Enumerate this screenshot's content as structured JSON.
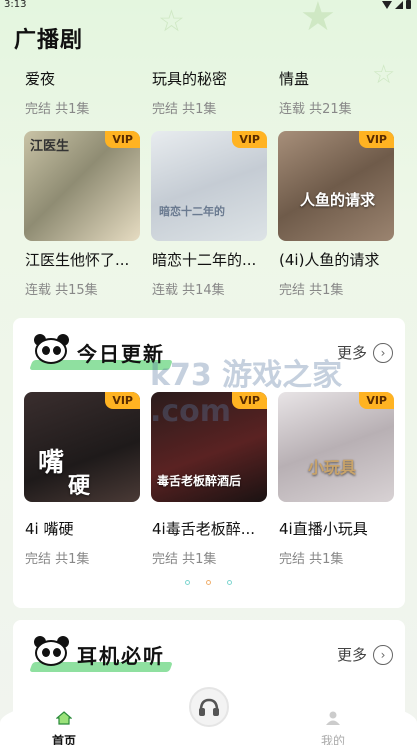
{
  "status_bar": {
    "time": "3:13"
  },
  "page": {
    "title": "广播剧"
  },
  "top_row": [
    {
      "title": "爱夜",
      "sub": "完结 共1集"
    },
    {
      "title": "玩具的秘密",
      "sub": "完结 共1集"
    },
    {
      "title": "情蛊",
      "sub": "连载 共21集"
    }
  ],
  "second_row": [
    {
      "title": "江医生他怀了...",
      "sub": "连载 共15集",
      "badge": "VIP",
      "cover_text": "江医生"
    },
    {
      "title": "暗恋十二年的...",
      "sub": "连载 共14集",
      "badge": "VIP",
      "cover_text": "暗恋十二年的"
    },
    {
      "title": "(4i)人鱼的请求",
      "sub": "完结 共1集",
      "badge": "VIP",
      "cover_text": "人鱼的请求"
    }
  ],
  "today_section": {
    "title": "今日更新",
    "more": "更多",
    "items": [
      {
        "title": "4i 嘴硬",
        "sub": "完结 共1集",
        "badge": "VIP",
        "cover_text_1": "嘴",
        "cover_text_2": "硬"
      },
      {
        "title": "4i毒舌老板醉...",
        "sub": "完结 共1集",
        "badge": "VIP",
        "cover_text": "毒舌老板醉酒后"
      },
      {
        "title": "4i直播小玩具",
        "sub": "完结 共1集",
        "badge": "VIP",
        "cover_text": "小玩具"
      }
    ]
  },
  "headphone_section": {
    "title": "耳机必听",
    "more": "更多"
  },
  "watermark": "k73 游戏之家 .com",
  "tabbar": {
    "home": "首页",
    "mine": "我的"
  },
  "colors": {
    "vip": "#ffb322",
    "accent_green": "#8fe0a0",
    "home_active": "#2a8a3a"
  }
}
